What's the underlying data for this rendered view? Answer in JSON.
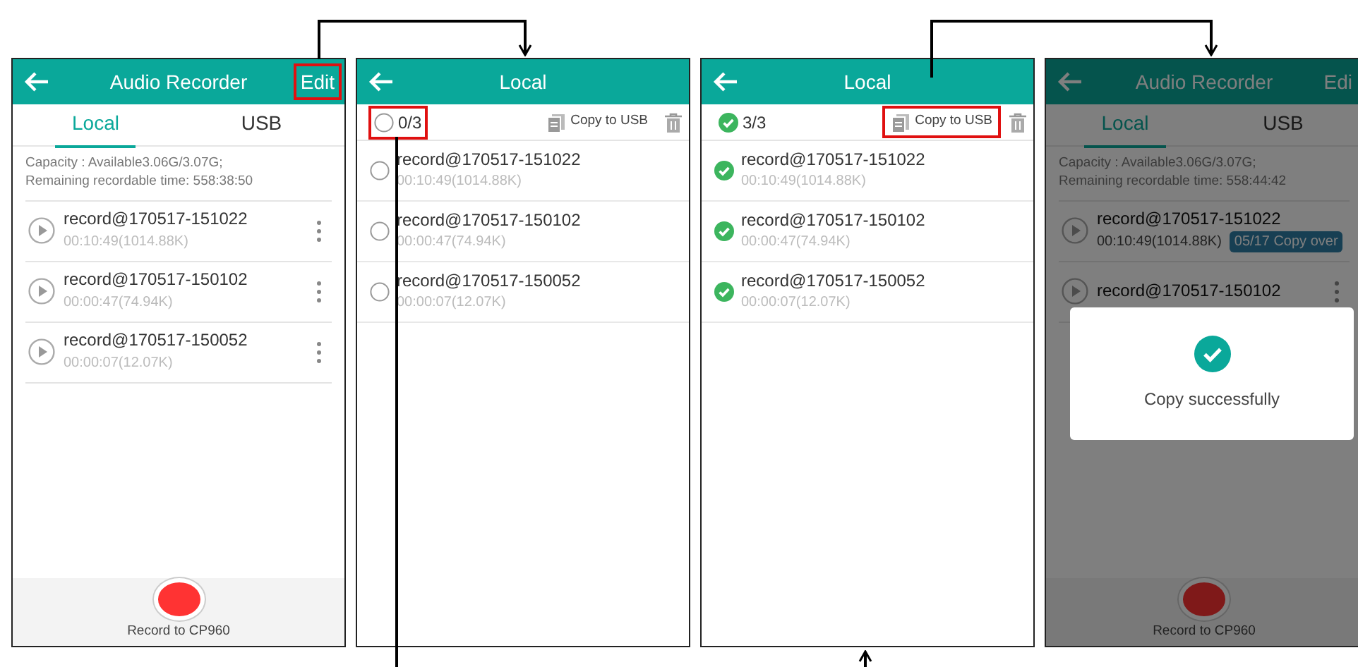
{
  "screens": [
    {
      "kind": "recorder",
      "dimmed": false,
      "header": {
        "title": "Audio Recorder",
        "action": "Edit",
        "action_highlighted": true
      },
      "tabs": [
        {
          "label": "Local",
          "selected": true
        },
        {
          "label": "USB",
          "selected": false
        }
      ],
      "capacity": [
        "Capacity : Available3.06G/3.07G;",
        "Remaining recordable time: 558:38:50"
      ],
      "records": [
        {
          "name": "record@170517-151022",
          "info": "00:10:49(1014.88K)"
        },
        {
          "name": "record@170517-150102",
          "info": "00:00:47(74.94K)"
        },
        {
          "name": "record@170517-150052",
          "info": "00:00:07(12.07K)"
        }
      ],
      "record_button": {
        "label": "Record to CP960"
      }
    },
    {
      "kind": "select",
      "header": {
        "title": "Local"
      },
      "toolbar": {
        "count": "0/3",
        "all_selected": false,
        "count_highlighted": true,
        "copy_label": "Copy to USB",
        "copy_highlighted": false
      },
      "records": [
        {
          "name": "record@170517-151022",
          "info": "00:10:49(1014.88K)",
          "selected": false
        },
        {
          "name": "record@170517-150102",
          "info": "00:00:47(74.94K)",
          "selected": false
        },
        {
          "name": "record@170517-150052",
          "info": "00:00:07(12.07K)",
          "selected": false
        }
      ]
    },
    {
      "kind": "select",
      "header": {
        "title": "Local"
      },
      "toolbar": {
        "count": "3/3",
        "all_selected": true,
        "count_highlighted": false,
        "copy_label": "Copy to USB",
        "copy_highlighted": true
      },
      "records": [
        {
          "name": "record@170517-151022",
          "info": "00:10:49(1014.88K)",
          "selected": true
        },
        {
          "name": "record@170517-150102",
          "info": "00:00:47(74.94K)",
          "selected": true
        },
        {
          "name": "record@170517-150052",
          "info": "00:00:07(12.07K)",
          "selected": true
        }
      ]
    },
    {
      "kind": "recorder",
      "dimmed": true,
      "header": {
        "title": "Audio Recorder",
        "action": "Edi",
        "action_highlighted": false
      },
      "tabs": [
        {
          "label": "Local",
          "selected": true
        },
        {
          "label": "USB",
          "selected": false
        }
      ],
      "capacity": [
        "Capacity : Available3.06G/3.07G;",
        "Remaining recordable time: 558:44:42"
      ],
      "records": [
        {
          "name": "record@170517-151022",
          "info": "00:10:49(1014.88K)",
          "badge": "05/17 Copy over"
        },
        {
          "name": "record@170517-150102"
        }
      ],
      "record_button": {
        "label": "Record to CP960"
      },
      "dialog": {
        "message": "Copy successfully"
      }
    }
  ]
}
